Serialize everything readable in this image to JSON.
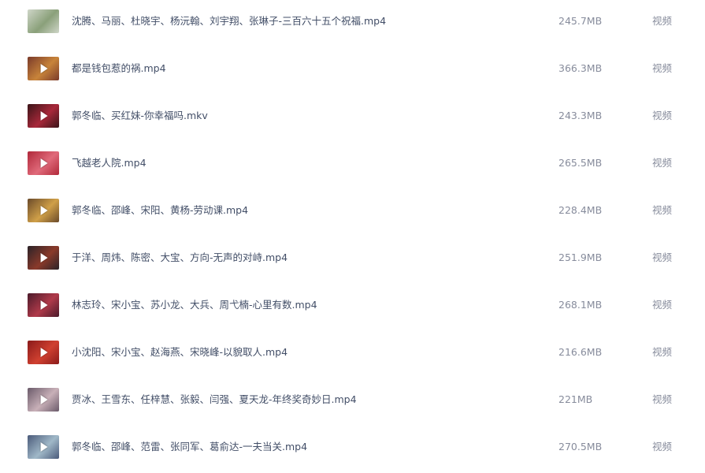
{
  "files": [
    {
      "name": "沈腾、马丽、杜晓宇、杨沅翰、刘宇翔、张琳子-三百六十五个祝福.mp4",
      "size": "245.7MB",
      "type": "视频",
      "thumb_colors": [
        "#cfd6c8",
        "#8aa07a"
      ],
      "play": false
    },
    {
      "name": "都是钱包惹的祸.mp4",
      "size": "366.3MB",
      "type": "视频",
      "thumb_colors": [
        "#7a3a2a",
        "#c8843a"
      ],
      "play": true
    },
    {
      "name": "郭冬临、买红妹-你幸福吗.mkv",
      "size": "243.3MB",
      "type": "视频",
      "thumb_colors": [
        "#3a1418",
        "#a8283a"
      ],
      "play": true
    },
    {
      "name": "飞越老人院.mp4",
      "size": "265.5MB",
      "type": "视频",
      "thumb_colors": [
        "#b0283a",
        "#e06a7a"
      ],
      "play": true
    },
    {
      "name": "郭冬临、邵峰、宋阳、黄杨-劳动课.mp4",
      "size": "228.4MB",
      "type": "视频",
      "thumb_colors": [
        "#6a4a2a",
        "#d0a048"
      ],
      "play": true
    },
    {
      "name": "于洋、周炜、陈密、大宝、方向-无声的对峙.mp4",
      "size": "251.9MB",
      "type": "视频",
      "thumb_colors": [
        "#2a2228",
        "#8a3a2a"
      ],
      "play": true
    },
    {
      "name": "林志玲、宋小宝、苏小龙、大兵、周弋楠-心里有数.mp4",
      "size": "268.1MB",
      "type": "视频",
      "thumb_colors": [
        "#4a1a2a",
        "#b03a4a"
      ],
      "play": true
    },
    {
      "name": "小沈阳、宋小宝、赵海燕、宋晓峰-以貌取人.mp4",
      "size": "216.6MB",
      "type": "视频",
      "thumb_colors": [
        "#8a1a1a",
        "#d04030"
      ],
      "play": true
    },
    {
      "name": "贾冰、王雪东、任梓慧、张毅、闫强、夏天龙-年终奖奇妙日.mp4",
      "size": "221MB",
      "type": "视频",
      "thumb_colors": [
        "#6a5a6a",
        "#c8b0b8"
      ],
      "play": true
    },
    {
      "name": "郭冬临、邵峰、范雷、张同军、葛俞达-一夫当关.mp4",
      "size": "270.5MB",
      "type": "视频",
      "thumb_colors": [
        "#4a5a7a",
        "#a0b8c8"
      ],
      "play": true
    }
  ]
}
